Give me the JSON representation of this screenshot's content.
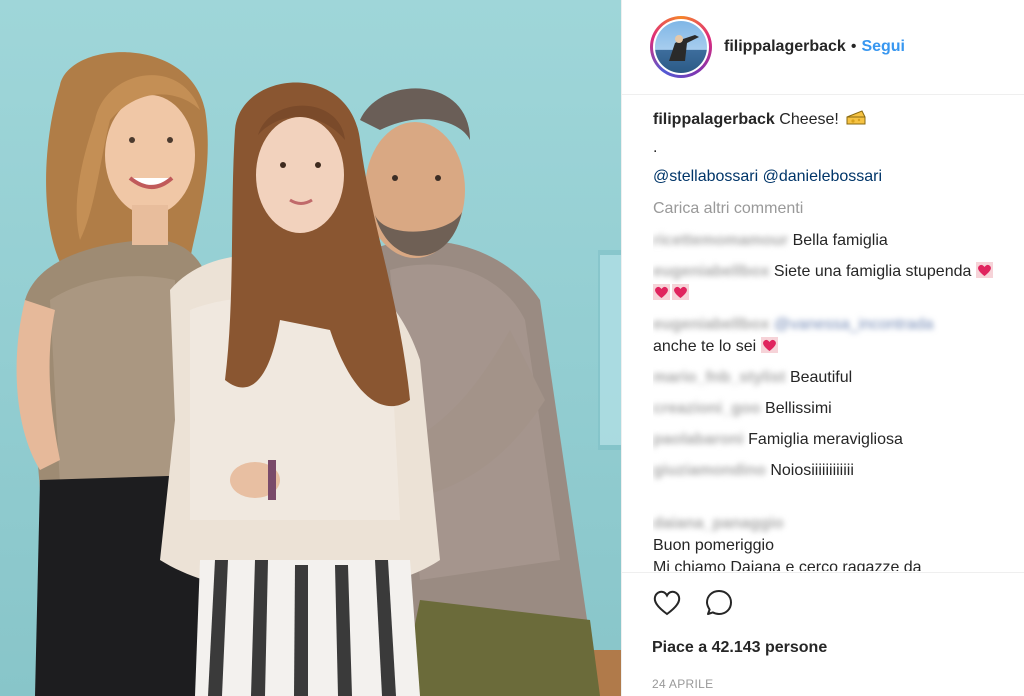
{
  "post": {
    "username": "filippalagerback",
    "follow_label": "Segui",
    "separator": "•",
    "caption_text": "Cheese!",
    "caption_dot": ".",
    "mentions": "@stellabossari @danielebossari",
    "load_more_label": "Carica altri commenti"
  },
  "comments": [
    {
      "user": "ricettemomamour",
      "text": "Bella famiglia"
    },
    {
      "user": "eugeniabellbox",
      "text": "Siete una famiglia stupenda"
    },
    {
      "user": "eugeniabellbox",
      "link": "@vanessa_incontrada",
      "text": "anche te lo sei"
    },
    {
      "user": "mario_fnb_stylist",
      "text": "Beautiful"
    },
    {
      "user": "creazioni_goo",
      "text": "Bellissimi"
    },
    {
      "user": "paolabaroni",
      "text": "Famiglia meravigliosa"
    },
    {
      "user": "giuziamondino",
      "text": "Noiosiiiiiiiiiiii"
    },
    {
      "user": "daiana_panaggio",
      "text": "Buon pomeriggio\nMi chiamo Daiana e cerco ragazze da"
    }
  ],
  "likes_label": "Piace a 42.143 persone",
  "date_label": "24 APRILE",
  "icons": {
    "like": "heart-outline-icon",
    "comment": "speech-bubble-icon",
    "emoji": [
      "cheese-emoji",
      "heart-emoji"
    ]
  },
  "colors": {
    "link": "#3897f0",
    "mention": "#003569",
    "muted": "#999999",
    "border": "#efefef",
    "photo_bg": "#9fd6d9"
  }
}
